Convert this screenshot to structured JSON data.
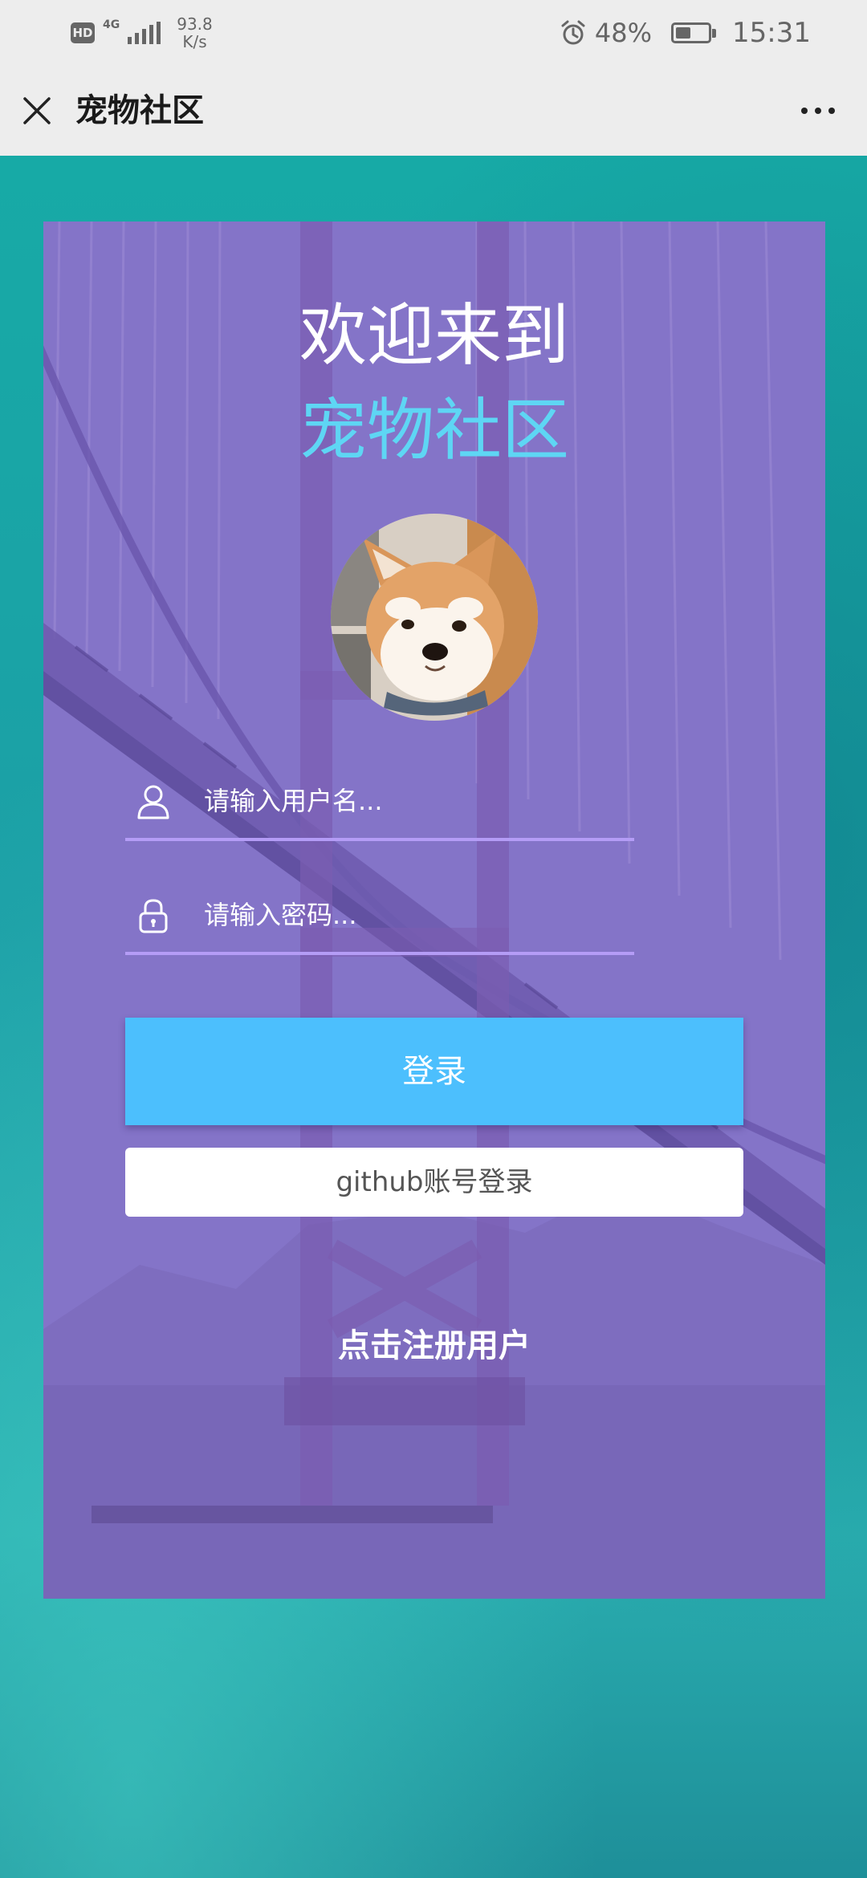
{
  "status_bar": {
    "hd_badge": "HD",
    "network_type": "4G",
    "speed_value": "93.8",
    "speed_unit": "K/s",
    "battery_percent": "48%",
    "battery_level": 0.48,
    "time": "15:31"
  },
  "title_bar": {
    "title": "宠物社区",
    "close_icon": "close-icon",
    "more_icon": "more-icon"
  },
  "login": {
    "welcome_line1": "欢迎来到",
    "welcome_line2": "宠物社区",
    "username_placeholder": "请输入用户名...",
    "password_placeholder": "请输入密码...",
    "login_button": "登录",
    "github_button": "github账号登录",
    "register_link": "点击注册用户"
  },
  "colors": {
    "card": "#8474c8",
    "accent_text": "#5ed6f4",
    "login_button": "#4cbffd",
    "field_underline": "#b49cf6",
    "page_background": "#1fa9a6"
  }
}
